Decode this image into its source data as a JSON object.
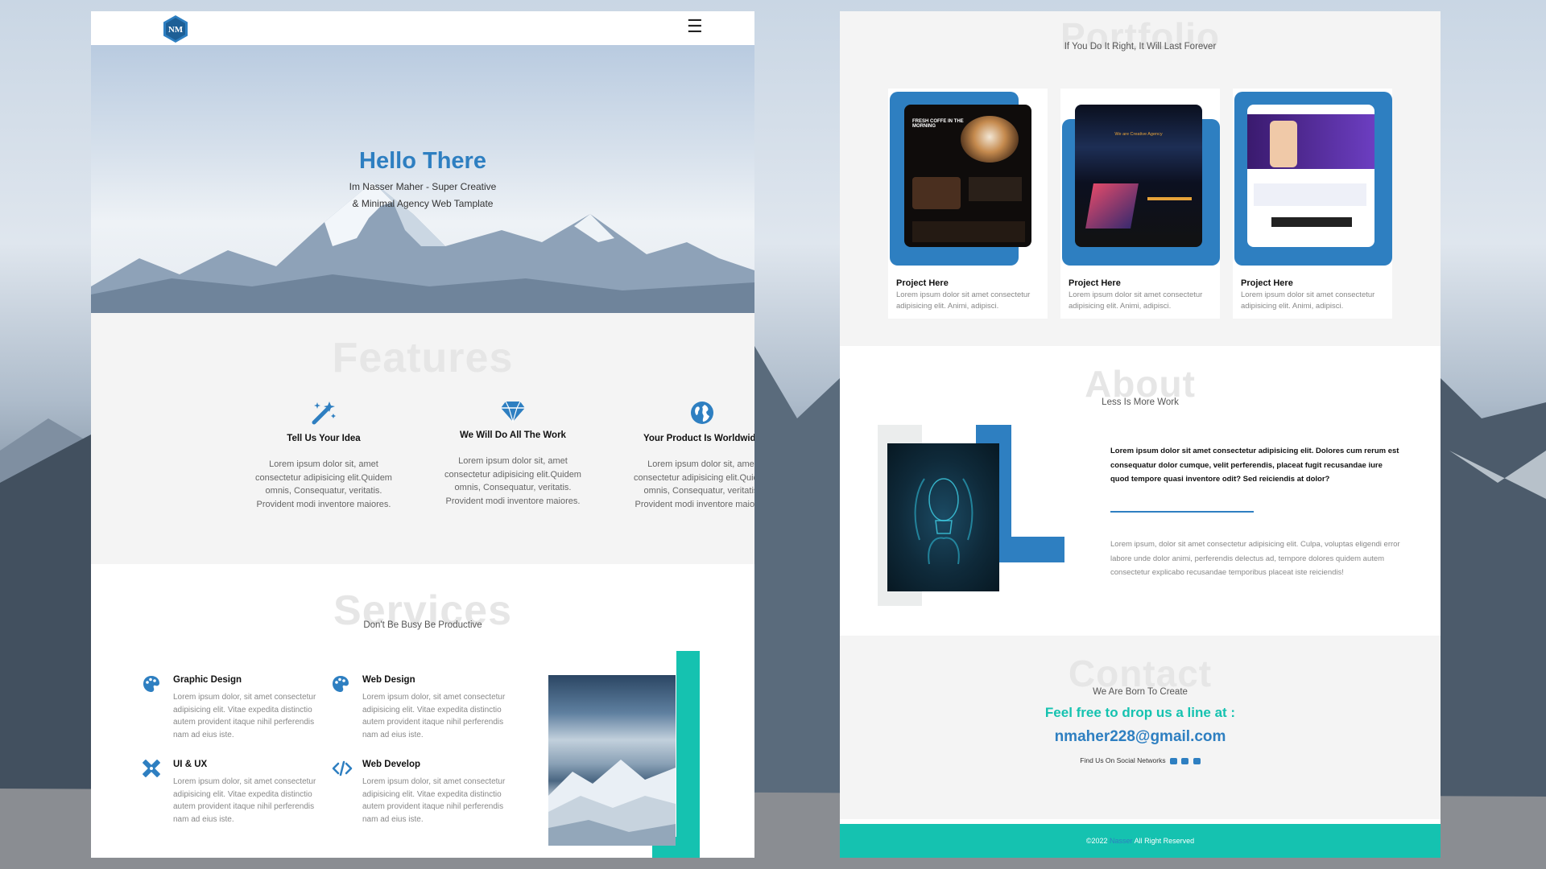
{
  "header": {
    "logo_text": "NM",
    "menu_icon": "hamburger-icon"
  },
  "hero": {
    "title": "Hello There",
    "subtitle_line1": "Im Nasser Maher - Super Creative",
    "subtitle_line2": "& Minimal Agency Web Tamplate"
  },
  "features": {
    "ghost_title": "Features",
    "items": [
      {
        "icon": "magic-wand-icon",
        "title": "Tell Us Your Idea",
        "text": "Lorem ipsum dolor sit, amet consectetur adipisicing elit.Quidem omnis, Consequatur, veritatis. Provident modi inventore maiores."
      },
      {
        "icon": "diamond-icon",
        "title": "We Will Do All The Work",
        "text": "Lorem ipsum dolor sit, amet consectetur adipisicing elit.Quidem omnis, Consequatur, veritatis. Provident modi inventore maiores."
      },
      {
        "icon": "globe-icon",
        "title": "Your Product Is Worldwide",
        "text": "Lorem ipsum dolor sit, amet consectetur adipisicing elit.Quidem omnis, Consequatur, veritatis. Provident modi inventore maiores."
      }
    ]
  },
  "services": {
    "ghost_title": "Services",
    "subtitle": "Don't Be Busy Be Productive",
    "items": [
      {
        "icon": "palette-icon",
        "title": "Graphic Design",
        "text": "Lorem ipsum dolor, sit amet consectetur adipisicing elit. Vitae expedita distinctio autem provident itaque nihil perferendis nam ad eius iste."
      },
      {
        "icon": "palette-icon",
        "title": "Web Design",
        "text": "Lorem ipsum dolor, sit amet consectetur adipisicing elit. Vitae expedita distinctio autem provident itaque nihil perferendis nam ad eius iste."
      },
      {
        "icon": "pencil-ruler-icon",
        "title": "UI & UX",
        "text": "Lorem ipsum dolor, sit amet consectetur adipisicing elit. Vitae expedita distinctio autem provident itaque nihil perferendis nam ad eius iste."
      },
      {
        "icon": "code-icon",
        "title": "Web Develop",
        "text": "Lorem ipsum dolor, sit amet consectetur adipisicing elit. Vitae expedita distinctio autem provident itaque nihil perferendis nam ad eius iste."
      }
    ]
  },
  "portfolio": {
    "ghost_title": "Portfolio",
    "subtitle": "If You Do It Right, It Will Last Forever",
    "projects": [
      {
        "title": "Project Here",
        "text": "Lorem ipsum dolor sit amet consectetur adipisicing elit. Animi, adipisci.",
        "shot_caption": "FRESH COFFE IN THE MORNING"
      },
      {
        "title": "Project Here",
        "text": "Lorem ipsum dolor sit amet consectetur adipisicing elit. Animi, adipisci.",
        "shot_caption": "We are Creative Agency"
      },
      {
        "title": "Project Here",
        "text": "Lorem ipsum dolor sit amet consectetur adipisicing elit. Animi, adipisci.",
        "shot_caption": ""
      }
    ]
  },
  "about": {
    "ghost_title": "About",
    "subtitle": "Less Is More Work",
    "bold_text": "Lorem ipsum dolor sit amet consectetur adipisicing elit. Dolores cum rerum est consequatur dolor cumque, velit perferendis, placeat fugit recusandae iure quod tempore quasi inventore odit? Sed reiciendis at dolor?",
    "text": "Lorem ipsum, dolor sit amet consectetur adipisicing elit. Culpa, voluptas eligendi error labore unde dolor animi, perferendis delectus ad, tempore dolores quidem autem consectetur explicabo recusandae temporibus placeat iste reiciendis!"
  },
  "contact": {
    "ghost_title": "Contact",
    "subtitle": "We Are Born To Create",
    "lead": "Feel free to drop us a line at :",
    "email": "nmaher228@gmail.com",
    "social_label": "Find Us On Social Networks",
    "social_icons": [
      "youtube-icon",
      "facebook-icon",
      "twitter-icon"
    ]
  },
  "footer": {
    "prefix": "©2022 ",
    "brand": "Nasser",
    "suffix": " All Right Reserved"
  },
  "colors": {
    "accent_blue": "#2e7fc1",
    "accent_teal": "#15c2b0"
  }
}
